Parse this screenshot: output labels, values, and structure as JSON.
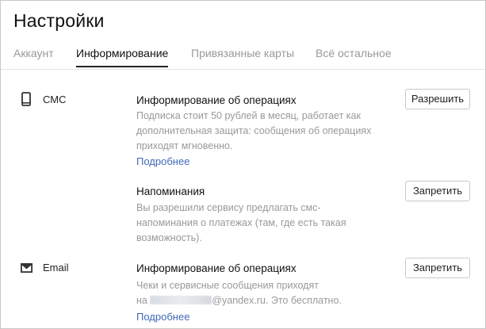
{
  "page": {
    "title": "Настройки"
  },
  "tabs": [
    {
      "label": "Аккаунт",
      "active": false
    },
    {
      "label": "Информирование",
      "active": true
    },
    {
      "label": "Привязанные карты",
      "active": false
    },
    {
      "label": "Всё остальное",
      "active": false
    }
  ],
  "sms": {
    "label": "СМС",
    "icon": "phone-icon",
    "operations": {
      "title": "Информирование об операциях",
      "description": "Подписка стоит 50 рублей в месяц, работает как дополнительная защита: сообщения об операциях приходят мгновенно.",
      "link": "Подробнее",
      "button": "Разрешить"
    },
    "reminders": {
      "title": "Напоминания",
      "description": "Вы разрешили сервису предлагать смс-напоминания о платежах (там, где есть такая возможность).",
      "button": "Запретить"
    }
  },
  "email": {
    "label": "Email",
    "icon": "envelope-icon",
    "operations": {
      "title": "Информирование об операциях",
      "description_line1": "Чеки и сервисные сообщения приходят",
      "description_prefix": "на ",
      "description_suffix": "@yandex.ru. Это бесплатно.",
      "link": "Подробнее",
      "button": "Запретить"
    }
  }
}
